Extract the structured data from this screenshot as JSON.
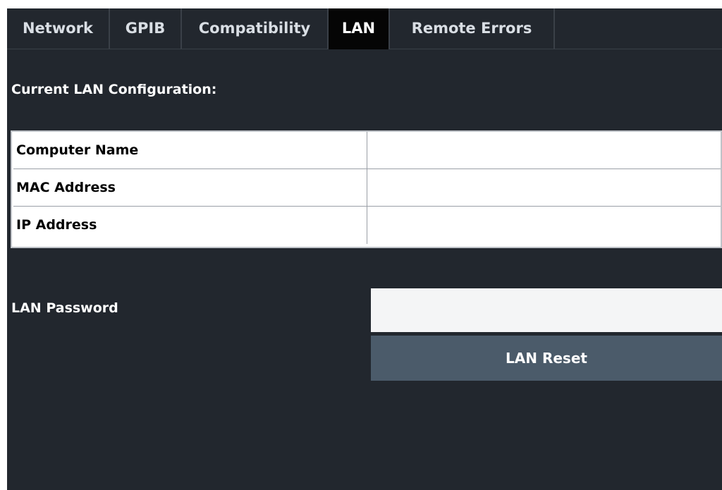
{
  "tabs": [
    {
      "label": "Network",
      "active": false
    },
    {
      "label": "GPIB",
      "active": false
    },
    {
      "label": "Compatibility",
      "active": false
    },
    {
      "label": "LAN",
      "active": true
    },
    {
      "label": "Remote Errors",
      "active": false
    }
  ],
  "lan": {
    "section_title": "Current LAN Configuration:",
    "table": [
      {
        "label": "Computer Name",
        "value": ""
      },
      {
        "label": "MAC Address",
        "value": ""
      },
      {
        "label": "IP Address",
        "value": ""
      }
    ],
    "password_label": "LAN Password",
    "password_value": "",
    "reset_label": "LAN Reset"
  },
  "colors": {
    "background": "#22272e",
    "active_tab": "#050505",
    "button": "#4b5b6a"
  }
}
